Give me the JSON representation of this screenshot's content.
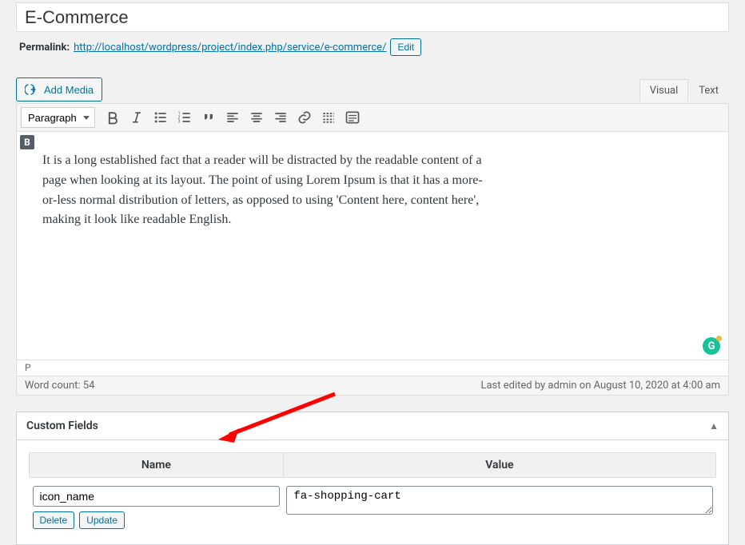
{
  "title": "E-Commerce",
  "permalink": {
    "label": "Permalink:",
    "url": "http://localhost/wordpress/project/index.php/service/e-commerce/",
    "edit_label": "Edit"
  },
  "add_media_label": "Add Media",
  "tabs": {
    "visual": "Visual",
    "text": "Text"
  },
  "format_select": "Paragraph",
  "editor_corner": "B",
  "editor_content": "It is a long established fact that a reader will be distracted by the readable content of a page when looking at its layout. The point of using Lorem Ipsum is that it has a more-or-less normal distribution of letters, as opposed to using 'Content here, content here', making it look like readable English.",
  "path_bar": "P",
  "word_count_label": "Word count: 54",
  "last_edited": "Last edited by admin on August 10, 2020 at 4:00 am",
  "custom_fields": {
    "heading": "Custom Fields",
    "col_name": "Name",
    "col_value": "Value",
    "rows": [
      {
        "name": "icon_name",
        "value": "fa-shopping-cart"
      }
    ],
    "delete_label": "Delete",
    "update_label": "Update"
  },
  "grammarly": "G"
}
